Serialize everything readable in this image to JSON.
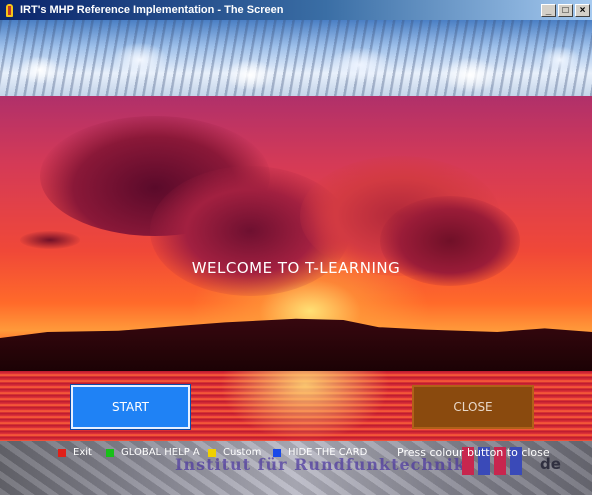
{
  "window": {
    "title": "IRT's MHP Reference Implementation - The Screen",
    "controls": {
      "minimize": "_",
      "maximize": "□",
      "close": "×"
    }
  },
  "main": {
    "welcome_text": "WELCOME TO T-LEARNING",
    "start_label": "START",
    "close_label": "CLOSE"
  },
  "footer": {
    "legend": [
      {
        "label": "Exit",
        "color": "#e02018"
      },
      {
        "label": "GLOBAL HELP A",
        "color": "#18c018"
      },
      {
        "label": "Custom",
        "color": "#f0d000"
      },
      {
        "label": "HIDE THE CARD",
        "color": "#1848e8"
      }
    ],
    "hint": "Press colour button to close",
    "logo_text": "Institut für Rundfunktechnik",
    "domain_suffix": "de"
  },
  "colors": {
    "start_button": "#1f82f5",
    "close_button": "#8a4a0e"
  }
}
